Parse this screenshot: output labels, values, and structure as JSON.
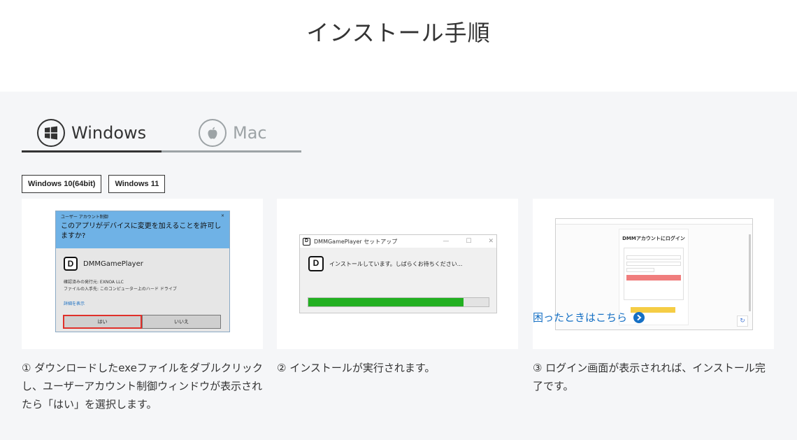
{
  "page": {
    "title": "インストール手順"
  },
  "tabs": [
    {
      "label": "Windows",
      "icon": "windows-logo-icon",
      "active": true
    },
    {
      "label": "Mac",
      "icon": "apple-logo-icon",
      "active": false
    }
  ],
  "os_badges": [
    "Windows 10(64bit)",
    "Windows 11"
  ],
  "steps": [
    {
      "text": "① ダウンロードしたexeファイルをダブルクリックし、ユーザーアカウント制御ウィンドウが表示されたら「はい」を選択します。"
    },
    {
      "text": "② インストールが実行されます。"
    },
    {
      "text": "③ ログイン画面が表示されれば、インストール完了です。"
    }
  ],
  "uac": {
    "window_title": "ユーザー アカウント制御",
    "close": "×",
    "question": "このアプリがデバイスに変更を加えることを許可しますか?",
    "app_name": "DMMGamePlayer",
    "publisher": "確認済みの発行元: EXNOA LLC",
    "origin": "ファイルの入手先: このコンピューター上のハード ドライブ",
    "details_link": "詳細を表示",
    "yes": "はい",
    "no": "いいえ"
  },
  "setup": {
    "title": "DMMGamePlayer セットアップ",
    "controls": [
      "—",
      "☐",
      "✕"
    ],
    "message": "インストールしています。しばらくお待ちください...",
    "progress": 0.86
  },
  "login": {
    "title": "DMMアカウントにログイン"
  },
  "trouble_link": "困ったときはこちら",
  "colors": {
    "accent_blue": "#1670c4",
    "uac_header": "#6fb2e6",
    "progress_green": "#22b021",
    "highlight_red": "#e0302a"
  }
}
